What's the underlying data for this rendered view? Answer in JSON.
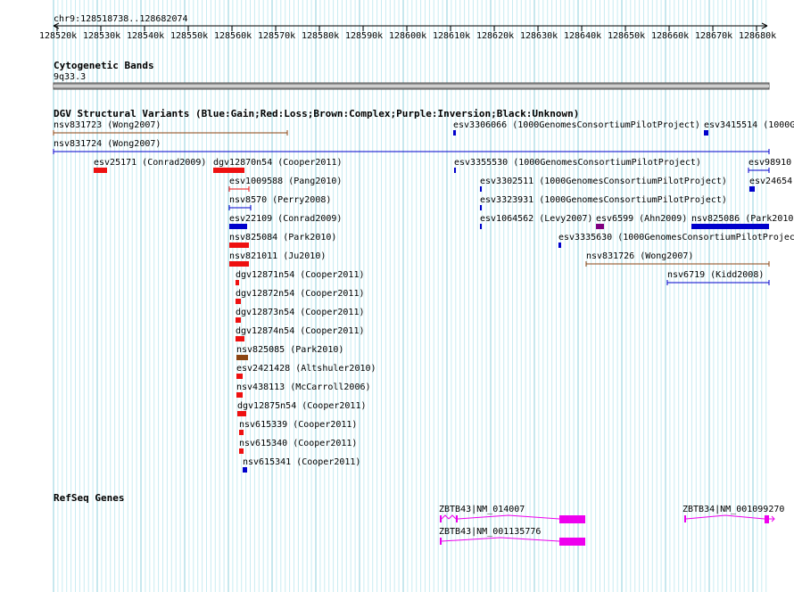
{
  "ruler": {
    "range_label": "chr9:128518738..128682074",
    "ticks": [
      "128520k",
      "128530k",
      "128540k",
      "128550k",
      "128560k",
      "128570k",
      "128580k",
      "128590k",
      "128600k",
      "128610k",
      "128620k",
      "128630k",
      "128640k",
      "128650k",
      "128660k",
      "128670k",
      "128680k"
    ]
  },
  "cytoband": {
    "title": "Cytogenetic Bands",
    "band": "9q33.3"
  },
  "dgv": {
    "title": "DGV Structural Variants (Blue:Gain;Red:Loss;Brown:Complex;Purple:Inversion;Black:Unknown)",
    "colors": {
      "gain": "#0000cc",
      "loss": "#ee1111",
      "complex": "#8b4513",
      "inversion": "#800080",
      "unknown": "#000000"
    },
    "variants": [
      {
        "label": "nsv831723 (Wong2007)",
        "type": "complex"
      },
      {
        "label": "esv3306066 (1000GenomesConsortiumPilotProject)",
        "type": "gain"
      },
      {
        "label": "esv3415514 (1000G",
        "type": "gain"
      },
      {
        "label": "nsv831724 (Wong2007)",
        "type": "gain"
      },
      {
        "label": "esv25171 (Conrad2009)",
        "type": "loss"
      },
      {
        "label": "dgv12870n54 (Cooper2011)",
        "type": "loss"
      },
      {
        "label": "esv3355530 (1000GenomesConsortiumPilotProject)",
        "type": "gain"
      },
      {
        "label": "esv98910",
        "type": "gain"
      },
      {
        "label": "esv1009588 (Pang2010)",
        "type": "loss"
      },
      {
        "label": "esv3302511 (1000GenomesConsortiumPilotProject)",
        "type": "gain"
      },
      {
        "label": "esv24654",
        "type": "gain"
      },
      {
        "label": "nsv8570 (Perry2008)",
        "type": "gain"
      },
      {
        "label": "esv3323931 (1000GenomesConsortiumPilotProject)",
        "type": "gain"
      },
      {
        "label": "esv22109 (Conrad2009)",
        "type": "gain"
      },
      {
        "label": "esv1064562 (Levy2007)",
        "type": "gain"
      },
      {
        "label": "esv6599 (Ahn2009)",
        "type": "inversion"
      },
      {
        "label": "nsv825086 (Park2010",
        "type": "gain"
      },
      {
        "label": "nsv825084 (Park2010)",
        "type": "loss"
      },
      {
        "label": "esv3335630 (1000GenomesConsortiumPilotProjec",
        "type": "gain"
      },
      {
        "label": "nsv821011 (Ju2010)",
        "type": "loss"
      },
      {
        "label": "nsv831726 (Wong2007)",
        "type": "complex"
      },
      {
        "label": "dgv12871n54 (Cooper2011)",
        "type": "loss"
      },
      {
        "label": "nsv6719 (Kidd2008)",
        "type": "gain"
      },
      {
        "label": "dgv12872n54 (Cooper2011)",
        "type": "loss"
      },
      {
        "label": "dgv12873n54 (Cooper2011)",
        "type": "loss"
      },
      {
        "label": "dgv12874n54 (Cooper2011)",
        "type": "loss"
      },
      {
        "label": "nsv825085 (Park2010)",
        "type": "complex"
      },
      {
        "label": "esv2421428 (Altshuler2010)",
        "type": "loss"
      },
      {
        "label": "nsv438113 (McCarroll2006)",
        "type": "loss"
      },
      {
        "label": "dgv12875n54 (Cooper2011)",
        "type": "loss"
      },
      {
        "label": "nsv615339 (Cooper2011)",
        "type": "loss"
      },
      {
        "label": "nsv615340 (Cooper2011)",
        "type": "loss"
      },
      {
        "label": "nsv615341 (Cooper2011)",
        "type": "gain"
      }
    ]
  },
  "refseq": {
    "title": "RefSeq Genes",
    "color": "#ee00ee",
    "genes": [
      {
        "label": "ZBTB43|NM_014007"
      },
      {
        "label": "ZBTB43|NM_001135776"
      },
      {
        "label": "ZBTB34|NM_001099270"
      }
    ]
  }
}
